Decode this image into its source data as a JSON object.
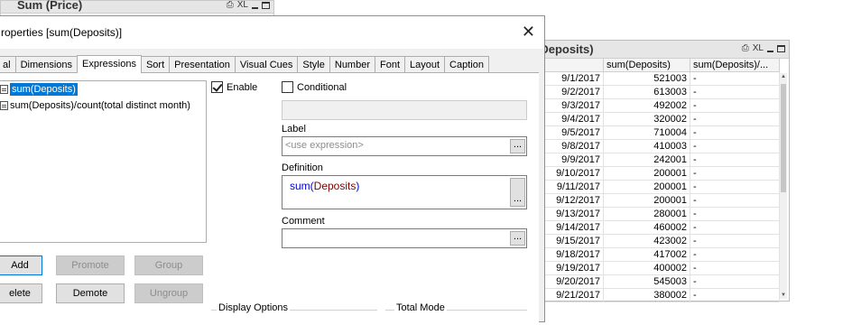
{
  "bg_chart": {
    "title": "Sum (Price)",
    "icon_xl": "XL"
  },
  "table_box": {
    "title": "(Deposits)",
    "icon_xl": "XL",
    "headers": [
      "",
      "sum(Deposits)",
      "sum(Deposits)/..."
    ],
    "rows": [
      {
        "date": "9/1/2017",
        "sum": "521003",
        "ratio": "-"
      },
      {
        "date": "9/2/2017",
        "sum": "613003",
        "ratio": "-"
      },
      {
        "date": "9/3/2017",
        "sum": "492002",
        "ratio": "-"
      },
      {
        "date": "9/4/2017",
        "sum": "320002",
        "ratio": "-"
      },
      {
        "date": "9/5/2017",
        "sum": "710004",
        "ratio": "-"
      },
      {
        "date": "9/8/2017",
        "sum": "410003",
        "ratio": "-"
      },
      {
        "date": "9/9/2017",
        "sum": "242001",
        "ratio": "-"
      },
      {
        "date": "9/10/2017",
        "sum": "200001",
        "ratio": "-"
      },
      {
        "date": "9/11/2017",
        "sum": "200001",
        "ratio": "-"
      },
      {
        "date": "9/12/2017",
        "sum": "200001",
        "ratio": "-"
      },
      {
        "date": "9/13/2017",
        "sum": "280001",
        "ratio": "-"
      },
      {
        "date": "9/14/2017",
        "sum": "460002",
        "ratio": "-"
      },
      {
        "date": "9/15/2017",
        "sum": "423002",
        "ratio": "-"
      },
      {
        "date": "9/18/2017",
        "sum": "417002",
        "ratio": "-"
      },
      {
        "date": "9/19/2017",
        "sum": "400002",
        "ratio": "-"
      },
      {
        "date": "9/20/2017",
        "sum": "545003",
        "ratio": "-"
      },
      {
        "date": "9/21/2017",
        "sum": "380002",
        "ratio": "-"
      }
    ]
  },
  "dialog": {
    "title": "roperties [sum(Deposits)]",
    "close_glyph": "✕",
    "tabs": [
      "al",
      "Dimensions",
      "Expressions",
      "Sort",
      "Presentation",
      "Visual Cues",
      "Style",
      "Number",
      "Font",
      "Layout",
      "Caption"
    ],
    "active_tab": "Expressions",
    "expressions": [
      {
        "label": "sum(Deposits)",
        "selected": true
      },
      {
        "label": "sum(Deposits)/count(total distinct month)",
        "selected": false
      }
    ],
    "buttons": {
      "add": "Add",
      "promote": "Promote",
      "group": "Group",
      "delete": "elete",
      "demote": "Demote",
      "ungroup": "Ungroup"
    },
    "enable_label": "Enable",
    "enable_checked": true,
    "conditional_label": "Conditional",
    "conditional_checked": false,
    "label_caption": "Label",
    "label_placeholder": "<use expression>",
    "definition_caption": "Definition",
    "definition_fn": "sum",
    "definition_open": "(",
    "definition_arg": "Deposits",
    "definition_close": ")",
    "comment_caption": "Comment",
    "ellipsis": "...",
    "display_options_title": "Display Options",
    "total_mode_title": "Total Mode"
  }
}
